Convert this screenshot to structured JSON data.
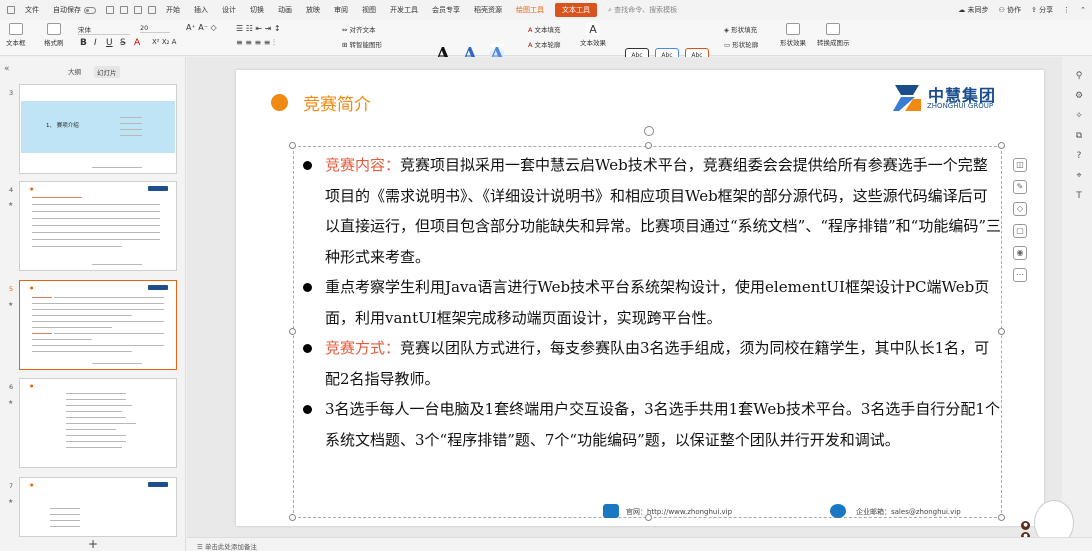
{
  "menubar": {
    "file": "文件",
    "autosave": "自动保存",
    "items": [
      "开始",
      "插入",
      "设计",
      "切换",
      "动画",
      "放映",
      "审阅",
      "视图",
      "开发工具",
      "会员专享",
      "稻壳资源"
    ],
    "drawing_tool": "绘图工具",
    "text_tool": "文本工具",
    "search_placeholder": "查找命令、搜索模板",
    "sync": "未同步",
    "collab": "协作",
    "share": "分享"
  },
  "toolbar": {
    "textbox": "文本框",
    "format_brush": "格式刷",
    "font_name": "宋体",
    "font_size": "20",
    "align_text": "对齐文本",
    "smartart": "转智能图形",
    "text_fill": "文本填充",
    "text_outline": "文本轮廓",
    "text_effect": "文本效果",
    "abc1": "Abc",
    "abc2": "Abc",
    "abc3": "Abc",
    "shape_fill": "形状填充",
    "shape_outline": "形状轮廓",
    "shape_effect": "形状效果",
    "convert_shape": "转换成图示"
  },
  "left_panel": {
    "tab_outline": "大纲",
    "tab_slides": "幻灯片",
    "slide_numbers": [
      "3",
      "4",
      "5",
      "6",
      "7"
    ],
    "thumb3_title": "1、 赛项介绍"
  },
  "slide": {
    "title": "竞赛简介",
    "logo_cn": "中慧集团",
    "logo_en": "ZHONGHUI GROUP",
    "bullets": [
      {
        "label": "竞赛内容：",
        "text": "竞赛项目拟采用一套中慧云启Web技术平台，竞赛组委会会提供给所有参赛选手一个完整项目的《需求说明书》、《详细设计说明书》和相应项目Web框架的部分源代码，这些源代码编译后可以直接运行，但项目包含部分功能缺失和异常。比赛项目通过“系统文档”、“程序排错”和“功能编码”三种形式来考查。"
      },
      {
        "label": "",
        "text": "重点考察学生利用Java语言进行Web技术平台系统架构设计，使用elementUI框架设计PC端Web页面，利用vantUI框架完成移动端页面设计，实现跨平台性。"
      },
      {
        "label": "竞赛方式：",
        "text": "竞赛以团队方式进行，每支参赛队由3名选手组成，须为同校在籍学生，其中队长1名，可配2名指导教师。"
      },
      {
        "label": "",
        "text": "3名选手每人一台电脑及1套终端用户交互设备，3名选手共用1套Web技术平台。3名选手自行分配1个系统文档题、3个“程序排错”题、7个“功能编码”题，以保证整个团队并行开发和调试。"
      }
    ],
    "footer_site": "官网：http://www.zhonghui.vip",
    "footer_mail": "企业邮箱：sales@zhonghui.vip"
  },
  "status": {
    "note": "单击此处添加备注"
  },
  "colors": {
    "accent_orange": "#f08a13",
    "label_red": "#e35b3c",
    "brand_blue": "#1a4d8c",
    "text_tool_bg": "#d9531e"
  }
}
